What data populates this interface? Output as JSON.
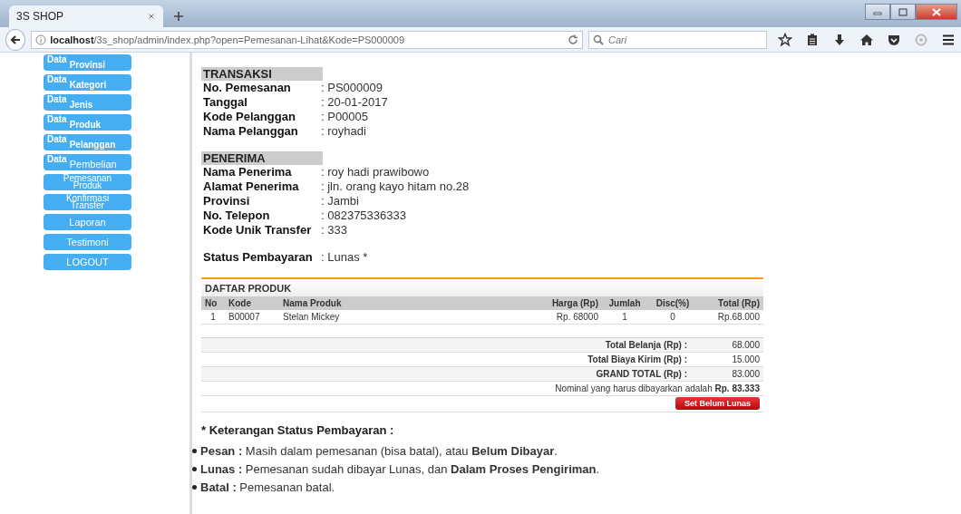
{
  "browser": {
    "tab_title": "3S SHOP",
    "url_host": "localhost",
    "url_path": "/3s_shop/admin/index.php?open=Pemesanan-Lihat&Kode=PS000009",
    "search": {
      "placeholder": "Cari"
    }
  },
  "sidebar": {
    "items": [
      {
        "kind": "data",
        "prefix": "Data",
        "label": "Provinsi"
      },
      {
        "kind": "data",
        "prefix": "Data",
        "label": "Kategori"
      },
      {
        "kind": "data",
        "prefix": "Data",
        "label": "Jenis"
      },
      {
        "kind": "data",
        "prefix": "Data",
        "label": "Produk"
      },
      {
        "kind": "data",
        "prefix": "Data",
        "label": "Pelanggan"
      },
      {
        "kind": "data-plain",
        "prefix": "Data",
        "label": "Pembelian"
      },
      {
        "kind": "two-line",
        "lines": [
          "Pemesanan",
          "Produk"
        ]
      },
      {
        "kind": "two-line",
        "lines": [
          "Konfirmasi",
          "Transfer"
        ]
      },
      {
        "kind": "plain",
        "label": "Laporan"
      },
      {
        "kind": "plain",
        "label": "Testimoni"
      },
      {
        "kind": "plain",
        "label": "LOGOUT"
      }
    ]
  },
  "sections": [
    {
      "title": "TRANSAKSI",
      "fields": [
        {
          "label": "No. Pemesanan",
          "value": ": PS000009"
        },
        {
          "label": "Tanggal",
          "value": ": 20-01-2017"
        },
        {
          "label": "Kode Pelanggan",
          "value": ": P00005"
        },
        {
          "label": "Nama Pelanggan",
          "value": ": royhadi"
        }
      ]
    },
    {
      "title": "PENERIMA",
      "fields": [
        {
          "label": "Nama Penerima",
          "value": ": roy hadi prawibowo"
        },
        {
          "label": "Alamat Penerima",
          "value": ": jln. orang kayo hitam no.28"
        },
        {
          "label": "Provinsi",
          "value": ": Jambi"
        },
        {
          "label": "No. Telepon",
          "value": ": 082375336333"
        },
        {
          "label": "Kode Unik Transfer",
          "value": ": 333"
        }
      ]
    }
  ],
  "status": {
    "label": "Status Pembayaran",
    "value": ": Lunas *"
  },
  "products": {
    "title": "DAFTAR PRODUK",
    "columns": [
      "No",
      "Kode",
      "Nama Produk",
      "Harga (Rp)",
      "Jumlah",
      "Disc(%)",
      "Total (Rp)"
    ],
    "rows": [
      [
        "1",
        "B00007",
        "Stelan Mickey",
        "Rp. 68000",
        "1",
        "0",
        "Rp.68.000"
      ]
    ],
    "totals": [
      {
        "label": "Total Belanja (Rp) :",
        "value": "68.000"
      },
      {
        "label": "Total Biaya Kirim (Rp) :",
        "value": "15.000"
      },
      {
        "label": "GRAND TOTAL (Rp) :",
        "value": "83.000"
      }
    ],
    "nominal": "Nominal yang harus dibayarkan adalah **Rp. 83.333**",
    "button": "Set Belum Lunas"
  },
  "notes": {
    "title": "* Keterangan Status Pembayaran :",
    "items": [
      "**Pesan :** Masih dalam pemesanan (bisa batal), atau **Belum Dibayar**.",
      "**Lunas :** Pemesanan sudah dibayar Lunas, dan **Dalam Proses Pengiriman**.",
      "**Batal :** Pemesanan batal."
    ]
  }
}
